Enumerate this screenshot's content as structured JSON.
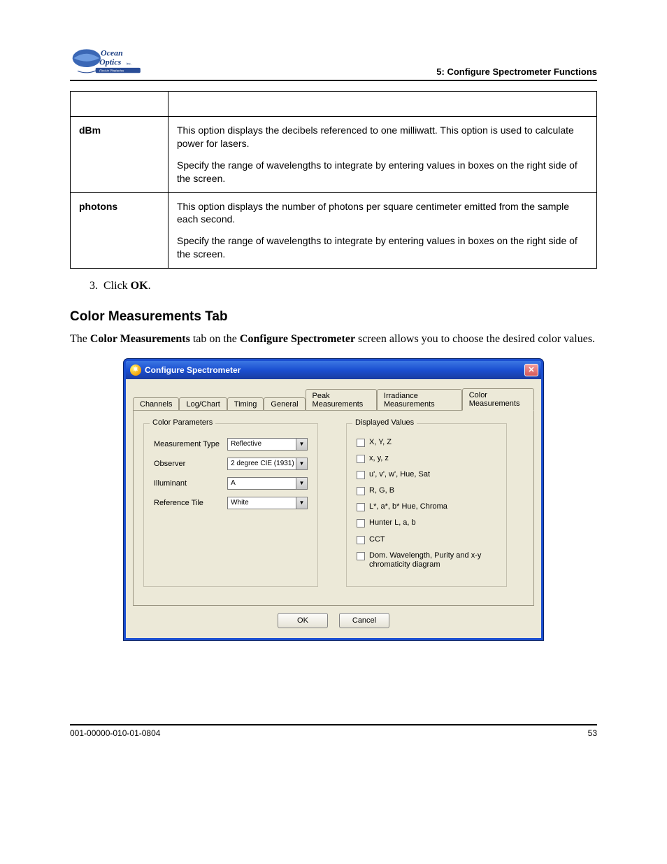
{
  "header": {
    "rightText": "5: Configure Spectrometer Functions"
  },
  "logo": {
    "line1": "Ocean",
    "line2": "Optics Inc.",
    "tagline": "First in Photonics"
  },
  "table": {
    "rows": [
      {
        "label": "dBm",
        "p1": "This option displays the decibels referenced to one milliwatt. This option is used to calculate power for lasers.",
        "p2": "Specify the range of wavelengths to integrate by entering values in boxes on the right side of the screen."
      },
      {
        "label": "photons",
        "p1": "This option displays the number of photons per square centimeter emitted from the sample each second.",
        "p2": "Specify the range of wavelengths to integrate by entering values in boxes on the right side of the screen."
      }
    ]
  },
  "step3": {
    "num": "3.",
    "text": "Click",
    "bold": "OK",
    "after": "."
  },
  "sectionTitle": "Color Measurements Tab",
  "intro": {
    "before": "The ",
    "b1": "Color Measurements",
    "mid": " tab on the ",
    "b2": "Configure Spectrometer",
    "after": " screen allows you to choose the desired color values."
  },
  "dialog": {
    "title": "Configure Spectrometer",
    "tabs": [
      "Channels",
      "Log/Chart",
      "Timing",
      "General",
      "Peak Measurements",
      "Irradiance Measurements",
      "Color Measurements"
    ],
    "activeTab": "Color Measurements",
    "leftGroup": {
      "legend": "Color Parameters",
      "fields": [
        {
          "label": "Measurement Type",
          "value": "Reflective"
        },
        {
          "label": "Observer",
          "value": "2 degree CIE (1931)"
        },
        {
          "label": "Illuminant",
          "value": "A"
        },
        {
          "label": "Reference Tile",
          "value": "White"
        }
      ]
    },
    "rightGroup": {
      "legend": "Displayed Values",
      "checks": [
        "X, Y, Z",
        "x, y, z",
        "u', v', w', Hue, Sat",
        "R, G, B",
        "L*, a*, b* Hue, Chroma",
        "Hunter L, a, b",
        "CCT",
        "Dom. Wavelength, Purity and x-y chromaticity diagram"
      ]
    },
    "buttons": {
      "ok": "OK",
      "cancel": "Cancel"
    }
  },
  "footer": {
    "left": "001-00000-010-01-0804",
    "right": "53"
  }
}
